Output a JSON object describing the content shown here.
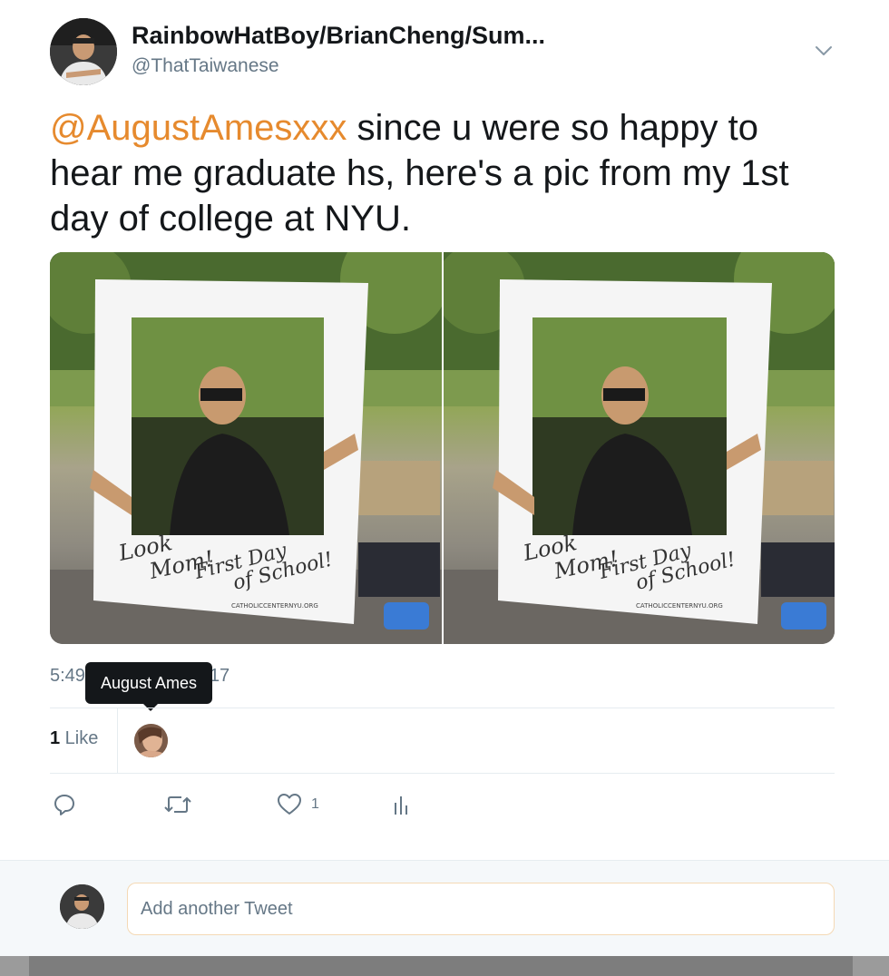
{
  "tweet": {
    "display_name": "RainbowHatBoy/BrianCheng/Sum...",
    "handle": "@ThatTaiwanese",
    "mention": "@AugustAmesxxx",
    "text": " since u were so happy to hear me graduate hs, here's a pic from my 1st day of college at NYU.",
    "photos": [
      {
        "sign_line1": "Look",
        "sign_line2": "Mom!",
        "sign_line3": "First Day",
        "sign_line4": "of School!",
        "sign_url": "CATHOLICCENTERNYU.ORG"
      },
      {
        "sign_line1": "Look",
        "sign_line2": "Mom!",
        "sign_line3": "First Day",
        "sign_line4": "of School!",
        "sign_url": "CATHOLICCENTERNYU.ORG"
      }
    ],
    "timestamp_left": "5:49",
    "timestamp_right": "17",
    "tooltip": "August Ames",
    "likes_number": "1",
    "likes_label": " Like",
    "actions": {
      "reply_icon": "reply-icon",
      "retweet_icon": "retweet-icon",
      "like_icon": "heart-icon",
      "like_count": "1",
      "analytics_icon": "analytics-icon"
    }
  },
  "reply": {
    "placeholder": "Add another Tweet"
  },
  "colors": {
    "mention": "#e68a2e",
    "secondary_text": "#657786",
    "tooltip_bg": "#14171a",
    "divider": "#e6ecf0"
  }
}
